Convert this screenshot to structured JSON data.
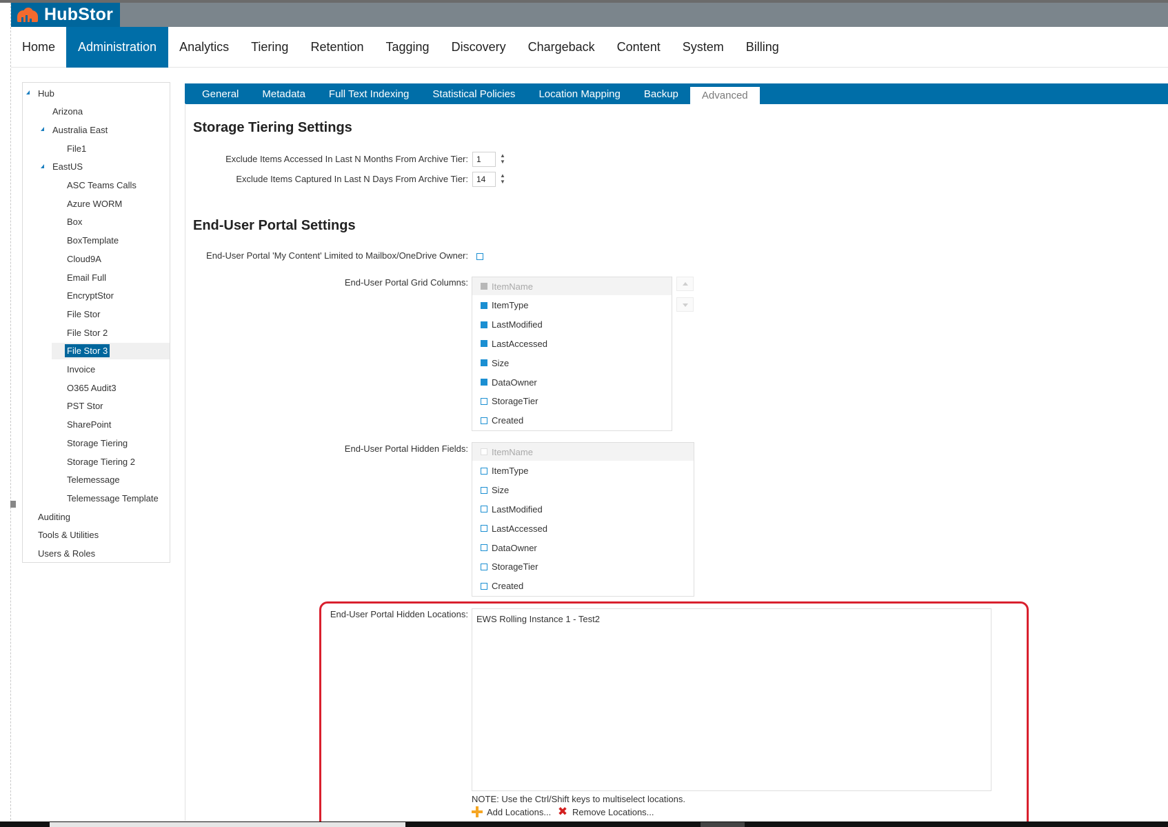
{
  "app": {
    "logo_text": "HubStor"
  },
  "main_nav": [
    {
      "label": "Home",
      "active": false
    },
    {
      "label": "Administration",
      "active": true
    },
    {
      "label": "Analytics",
      "active": false
    },
    {
      "label": "Tiering",
      "active": false
    },
    {
      "label": "Retention",
      "active": false
    },
    {
      "label": "Tagging",
      "active": false
    },
    {
      "label": "Discovery",
      "active": false
    },
    {
      "label": "Chargeback",
      "active": false
    },
    {
      "label": "Content",
      "active": false
    },
    {
      "label": "System",
      "active": false
    },
    {
      "label": "Billing",
      "active": false
    }
  ],
  "tree": [
    {
      "label": "Hub",
      "level": 0,
      "expanded": true
    },
    {
      "label": "Arizona",
      "level": 1
    },
    {
      "label": "Australia East",
      "level": 1,
      "expanded": true
    },
    {
      "label": "File1",
      "level": 2
    },
    {
      "label": "EastUS",
      "level": 1,
      "expanded": true
    },
    {
      "label": "ASC Teams Calls",
      "level": 2
    },
    {
      "label": "Azure WORM",
      "level": 2
    },
    {
      "label": "Box",
      "level": 2
    },
    {
      "label": "BoxTemplate",
      "level": 2
    },
    {
      "label": "Cloud9A",
      "level": 2
    },
    {
      "label": "Email Full",
      "level": 2
    },
    {
      "label": "EncryptStor",
      "level": 2
    },
    {
      "label": "File Stor",
      "level": 2
    },
    {
      "label": "File Stor 2",
      "level": 2
    },
    {
      "label": "File Stor 3",
      "level": 2,
      "selected": true
    },
    {
      "label": "Invoice",
      "level": 2
    },
    {
      "label": "O365 Audit3",
      "level": 2
    },
    {
      "label": "PST Stor",
      "level": 2
    },
    {
      "label": "SharePoint",
      "level": 2
    },
    {
      "label": "Storage Tiering",
      "level": 2
    },
    {
      "label": "Storage Tiering 2",
      "level": 2
    },
    {
      "label": "Telemessage",
      "level": 2
    },
    {
      "label": "Telemessage Template",
      "level": 2
    },
    {
      "label": "Auditing",
      "level": 0
    },
    {
      "label": "Tools & Utilities",
      "level": 0
    },
    {
      "label": "Users & Roles",
      "level": 0
    }
  ],
  "sub_tabs": [
    {
      "label": "General",
      "active": false
    },
    {
      "label": "Metadata",
      "active": false
    },
    {
      "label": "Full Text Indexing",
      "active": false
    },
    {
      "label": "Statistical Policies",
      "active": false
    },
    {
      "label": "Location Mapping",
      "active": false
    },
    {
      "label": "Backup",
      "active": false
    },
    {
      "label": "Advanced",
      "active": true
    }
  ],
  "storage_tiering": {
    "title": "Storage Tiering Settings",
    "months_label": "Exclude Items Accessed In Last N Months From Archive Tier:",
    "months_value": "1",
    "days_label": "Exclude Items Captured In Last N Days From Archive Tier:",
    "days_value": "14"
  },
  "portal": {
    "title": "End-User Portal Settings",
    "my_content_label": "End-User Portal 'My Content' Limited to Mailbox/OneDrive Owner:",
    "my_content_checked": false,
    "grid_columns_label": "End-User Portal Grid Columns:",
    "grid_columns": [
      {
        "label": "ItemName",
        "checked": true,
        "disabled": true
      },
      {
        "label": "ItemType",
        "checked": true
      },
      {
        "label": "LastModified",
        "checked": true
      },
      {
        "label": "LastAccessed",
        "checked": true
      },
      {
        "label": "Size",
        "checked": true
      },
      {
        "label": "DataOwner",
        "checked": true
      },
      {
        "label": "StorageTier",
        "checked": false
      },
      {
        "label": "Created",
        "checked": false
      }
    ],
    "hidden_fields_label": "End-User Portal Hidden Fields:",
    "hidden_fields": [
      {
        "label": "ItemName",
        "checked": false,
        "disabled": true
      },
      {
        "label": "ItemType",
        "checked": false
      },
      {
        "label": "Size",
        "checked": false
      },
      {
        "label": "LastModified",
        "checked": false
      },
      {
        "label": "LastAccessed",
        "checked": false
      },
      {
        "label": "DataOwner",
        "checked": false
      },
      {
        "label": "StorageTier",
        "checked": false
      },
      {
        "label": "Created",
        "checked": false
      }
    ],
    "hidden_locations_label": "End-User Portal Hidden Locations:",
    "hidden_locations": [
      "EWS Rolling Instance 1 - Test2"
    ],
    "note": "NOTE: Use the Ctrl/Shift keys to multiselect locations.",
    "add_label": "Add Locations...",
    "remove_label": "Remove Locations..."
  },
  "icons": {
    "logo": "hubstor-logo-icon",
    "tree_toggle": "expand-triangle-icon",
    "add": "plus-icon",
    "remove": "red-x-icon",
    "move_up": "arrow-up-icon",
    "move_down": "arrow-down-icon"
  },
  "colors": {
    "brand": "#00669c",
    "nav_active": "#006ea8",
    "checkbox": "#1b8fd2",
    "highlight": "#d9202e",
    "logo_accent": "#f26a2e"
  }
}
